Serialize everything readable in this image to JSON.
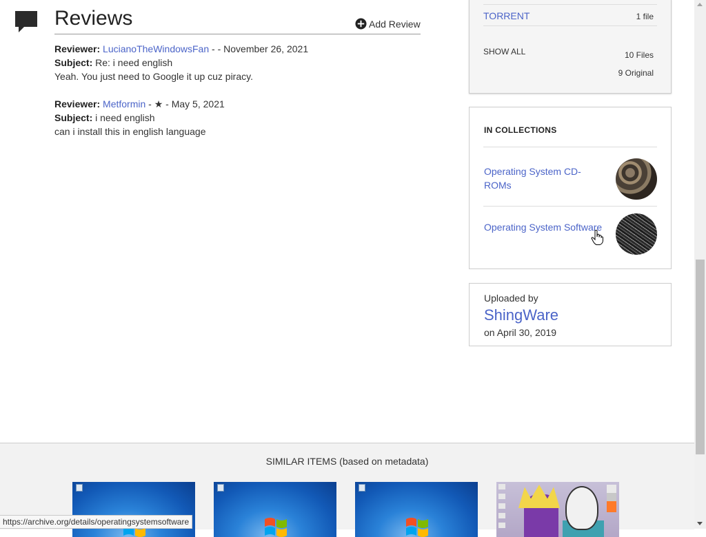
{
  "reviews": {
    "title": "Reviews",
    "add_review_label": "Add Review",
    "items": [
      {
        "reviewer_label": "Reviewer:",
        "reviewer": "LucianoTheWindowsFan",
        "meta": " - - November 26, 2021",
        "subject_label": "Subject:",
        "subject": "Re: i need english",
        "body": "Yeah. You just need to Google it up cuz piracy."
      },
      {
        "reviewer_label": "Reviewer:",
        "reviewer": "Metformin",
        "meta": " - ★ - May 5, 2021",
        "subject_label": "Subject:",
        "subject": "i need english",
        "body": "can i install this in english language"
      }
    ]
  },
  "downloads": {
    "torrent_label": "TORRENT",
    "torrent_count": "1 file",
    "show_all_label": "SHOW ALL",
    "files_count": "10 Files",
    "original_count": "9 Original"
  },
  "collections": {
    "heading": "IN COLLECTIONS",
    "items": [
      {
        "label": "Operating System CD-ROMs",
        "thumb_icon": "gears-thumbnail"
      },
      {
        "label": "Operating System Software",
        "thumb_icon": "circuit-thumbnail"
      }
    ]
  },
  "uploader": {
    "label": "Uploaded by",
    "name": "ShingWare",
    "date": "on April 30, 2019"
  },
  "similar": {
    "title": "SIMILAR ITEMS (based on metadata)",
    "items": [
      {
        "kind": "windows-7-desktop"
      },
      {
        "kind": "windows-7-desktop"
      },
      {
        "kind": "windows-7-desktop"
      },
      {
        "kind": "cartoon-desktop"
      }
    ]
  },
  "status_bar": {
    "url": "https://archive.org/details/operatingsystemsoftware"
  },
  "colors": {
    "link": "#4b64c8",
    "panel_bg": "#f5f5f5",
    "similar_bg": "#f2f2f2"
  }
}
